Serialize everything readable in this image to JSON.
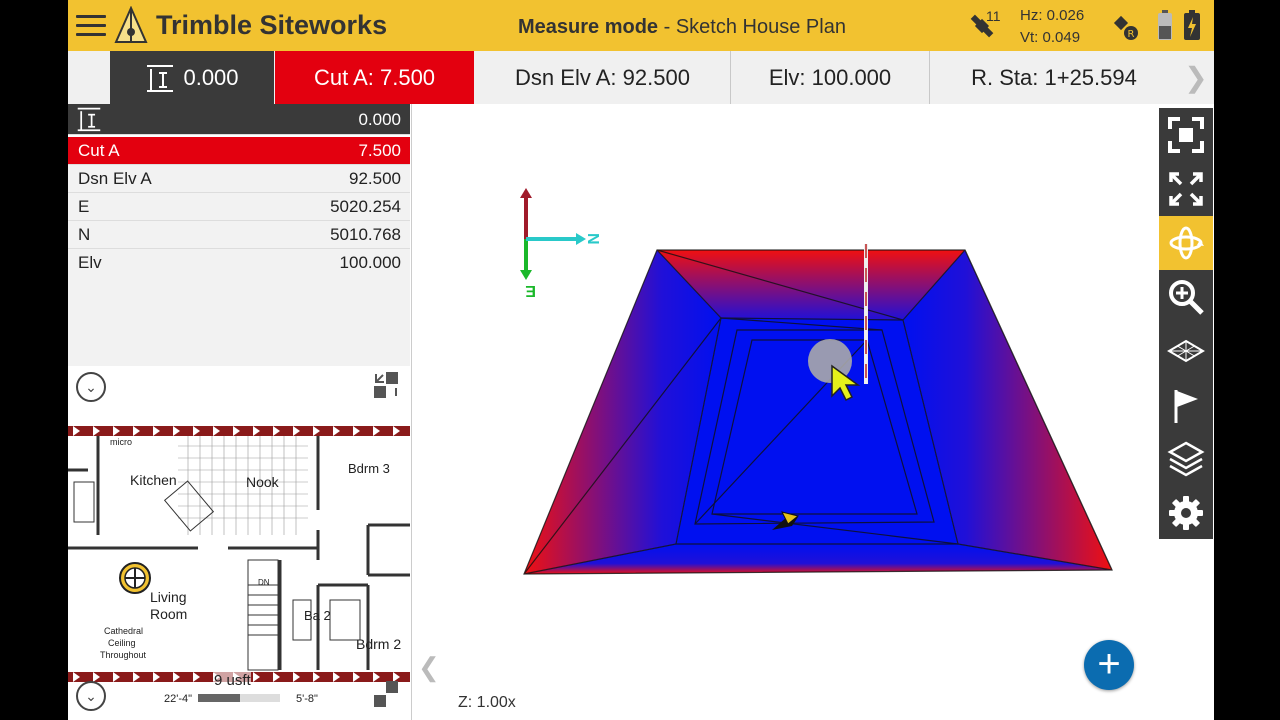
{
  "header": {
    "app_title": "Trimble Siteworks",
    "mode_label": "Measure mode",
    "mode_separator": " - ",
    "project_name": "Sketch House Plan",
    "satellite_count": "11",
    "hz": "Hz: 0.026",
    "vt": "Vt: 0.049",
    "brand_color": "#f2c230"
  },
  "status_bar": {
    "offset_value": "0.000",
    "cut": "Cut A: 7.500",
    "design_elevation": "Dsn Elv A: 92.500",
    "elevation": "Elv: 100.000",
    "station": "R. Sta: 1+25.594",
    "cut_color": "#e3000f"
  },
  "readout": {
    "offset": {
      "value": "0.000"
    },
    "cut": {
      "label": "Cut A",
      "value": "7.500"
    },
    "design_elevation": {
      "label": "Dsn Elv A",
      "value": "92.500"
    },
    "easting": {
      "label": "E",
      "value": "5020.254"
    },
    "northing": {
      "label": "N",
      "value": "5010.768"
    },
    "elevation": {
      "label": "Elv",
      "value": "100.000"
    }
  },
  "plan": {
    "rooms": [
      "micro",
      "Kitchen",
      "Nook",
      "Bdrm 3",
      "Living",
      "Room",
      "Cathedral",
      "Ceiling",
      "Throughout",
      "Ba 2",
      "Bdrm 2",
      "DN"
    ],
    "scale_label": "9 usft",
    "dimensions": [
      "22'-4\"",
      "5'-8\""
    ]
  },
  "scene": {
    "zoom": "Z: 1.00x",
    "axis_labels": {
      "north": "N",
      "east": "E"
    }
  },
  "toolbar": {
    "items": [
      "zoom-extents-icon",
      "fit-view-icon",
      "orbit-icon",
      "zoom-icon",
      "surface-icon",
      "flag-icon",
      "layers-icon",
      "settings-icon"
    ],
    "active": "orbit-icon"
  }
}
